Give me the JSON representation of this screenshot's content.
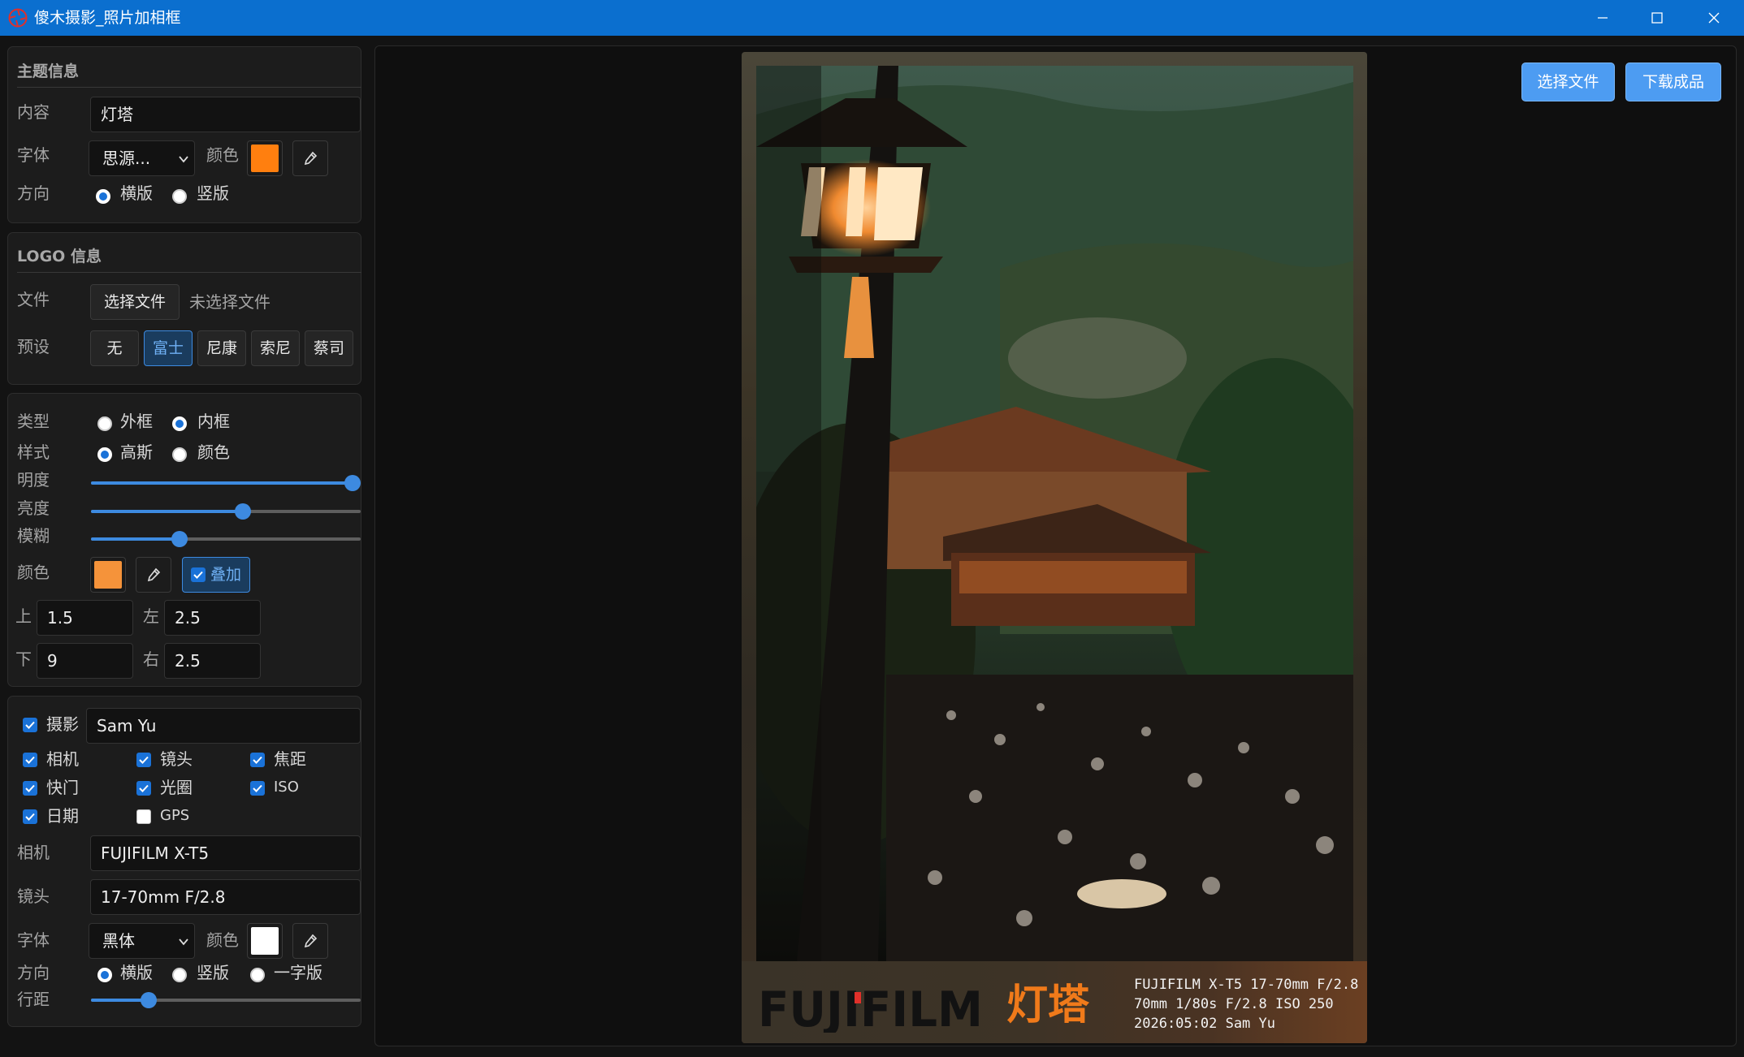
{
  "window": {
    "title": "傻木摄影_照片加相框",
    "app_icon": "camera-shutter-icon",
    "controls": [
      "minimize-icon",
      "maximize-icon",
      "close-icon"
    ]
  },
  "theme_section": {
    "title": "主题信息",
    "content_label": "内容",
    "content_value": "灯塔",
    "font_label": "字体",
    "font_value": "思源...",
    "color_label": "颜色",
    "color_value": "#ff7f0f",
    "orientation_label": "方向",
    "orientation_options": [
      "横版",
      "竖版"
    ],
    "orientation_selected": "横版"
  },
  "logo_section": {
    "title": "LOGO 信息",
    "file_label": "文件",
    "file_button": "选择文件",
    "file_status": "未选择文件",
    "preset_label": "预设",
    "presets": [
      "无",
      "富士",
      "尼康",
      "索尼",
      "蔡司"
    ],
    "preset_selected": "富士"
  },
  "frame_section": {
    "type_label": "类型",
    "type_options": [
      "外框",
      "内框"
    ],
    "type_selected": "内框",
    "style_label": "样式",
    "style_options": [
      "高斯",
      "颜色"
    ],
    "style_selected": "高斯",
    "sliders": [
      {
        "label": "明度",
        "value": 1.0
      },
      {
        "label": "亮度",
        "value": 0.58
      },
      {
        "label": "模糊",
        "value": 0.34
      }
    ],
    "color_label": "颜色",
    "color_value": "#f5933a",
    "overlay_label": "叠加",
    "overlay_checked": true,
    "margins": {
      "top_label": "上",
      "top_value": "1.5",
      "left_label": "左",
      "left_value": "2.5",
      "bottom_label": "下",
      "bottom_value": "9",
      "right_label": "右",
      "right_value": "2.5"
    }
  },
  "info_section": {
    "photographer_label": "摄影",
    "photographer_checked": true,
    "photographer_value": "Sam Yu",
    "options": [
      {
        "label": "相机",
        "checked": true
      },
      {
        "label": "镜头",
        "checked": true
      },
      {
        "label": "焦距",
        "checked": true
      },
      {
        "label": "快门",
        "checked": true
      },
      {
        "label": "光圈",
        "checked": true
      },
      {
        "label": "ISO",
        "checked": true
      },
      {
        "label": "日期",
        "checked": true
      },
      {
        "label": "GPS",
        "checked": false
      }
    ],
    "camera_label": "相机",
    "camera_value": "FUJIFILM X-T5",
    "lens_label": "镜头",
    "lens_value": "17-70mm F/2.8",
    "font_label": "字体",
    "font_value": "黑体",
    "color_label": "颜色",
    "color_value": "#ffffff",
    "orientation_label": "方向",
    "orientation_options": [
      "横版",
      "竖版",
      "一字版"
    ],
    "orientation_selected": "横版",
    "line_spacing_label": "行距",
    "line_spacing_value": 0.22
  },
  "toolbar": {
    "select_file": "选择文件",
    "download": "下载成品"
  },
  "preview": {
    "brand_logo": "FUJIFILM",
    "caption_title": "灯塔",
    "exif_line1": "FUJIFILM X-T5 17-70mm F/2.8",
    "exif_line2": "70mm 1/80s F/2.8 ISO 250",
    "exif_line3": "2026:05:02 Sam Yu",
    "title_color": "#f07a1a"
  }
}
